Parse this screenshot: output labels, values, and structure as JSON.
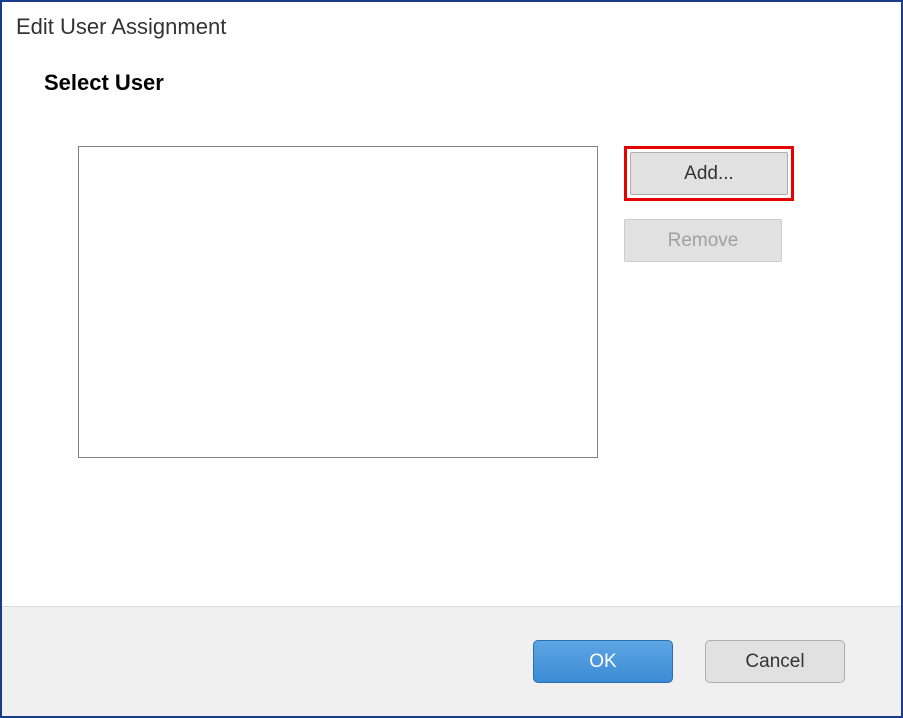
{
  "dialog": {
    "title": "Edit User Assignment"
  },
  "section": {
    "heading": "Select User"
  },
  "buttons": {
    "add": "Add...",
    "remove": "Remove",
    "ok": "OK",
    "cancel": "Cancel"
  }
}
